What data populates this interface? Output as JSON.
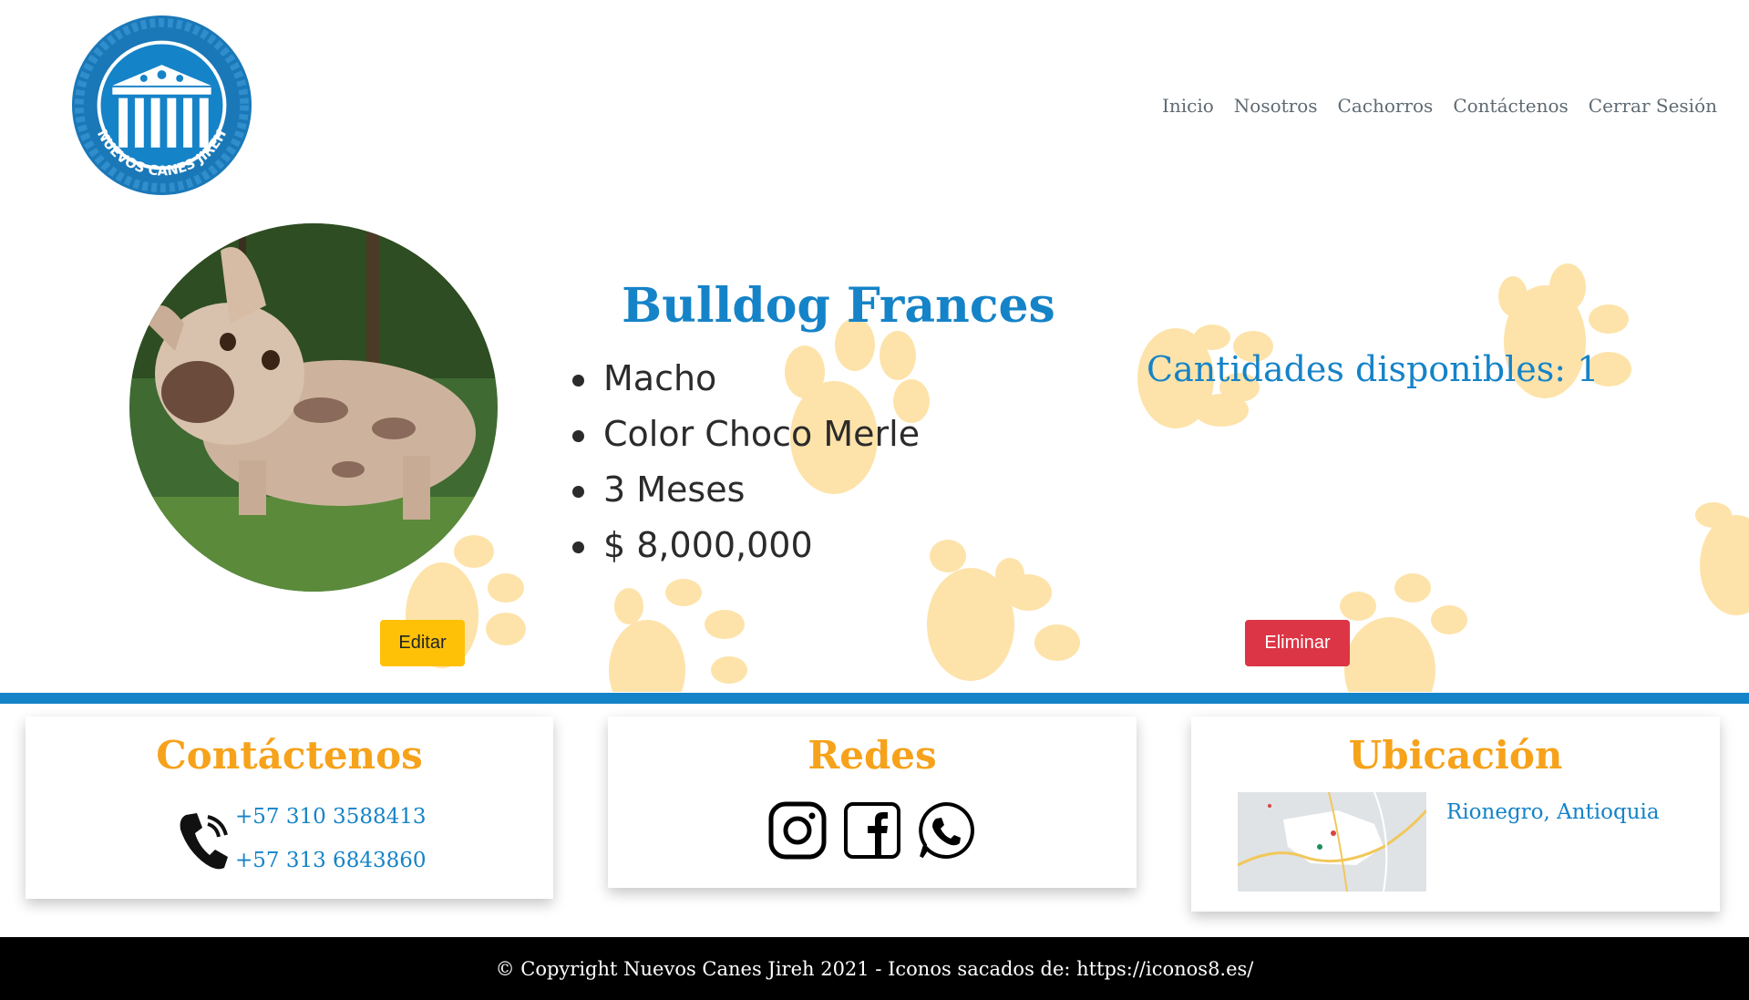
{
  "brand": {
    "logo_text": "NUEVOS CANES JIREH",
    "colors": {
      "primary": "#1583c8",
      "accent": "#f6a21b",
      "paw": "#fde3aa"
    }
  },
  "nav": {
    "items": [
      {
        "label": "Inicio"
      },
      {
        "label": "Nosotros"
      },
      {
        "label": "Cachorros"
      },
      {
        "label": "Contáctenos"
      },
      {
        "label": "Cerrar Sesión"
      }
    ]
  },
  "product": {
    "title": "Bulldog Frances",
    "features": [
      "Macho",
      "Color Choco Merle",
      "3 Meses",
      "$ 8,000,000"
    ],
    "stock_label": "Cantidades disponibles: 1",
    "edit_label": "Editar",
    "delete_label": "Eliminar"
  },
  "contact": {
    "title": "Contáctenos",
    "phones": [
      "+57 310 3588413",
      "+57 313 6843860"
    ],
    "icon": "phone-icon"
  },
  "social": {
    "title": "Redes",
    "icons": [
      "instagram-icon",
      "facebook-icon",
      "whatsapp-icon"
    ]
  },
  "location": {
    "title": "Ubicación",
    "place": "Rionegro, Antioquia"
  },
  "footer": {
    "text": "© Copyright Nuevos Canes Jireh 2021 - Iconos sacados de: https://iconos8.es/"
  }
}
